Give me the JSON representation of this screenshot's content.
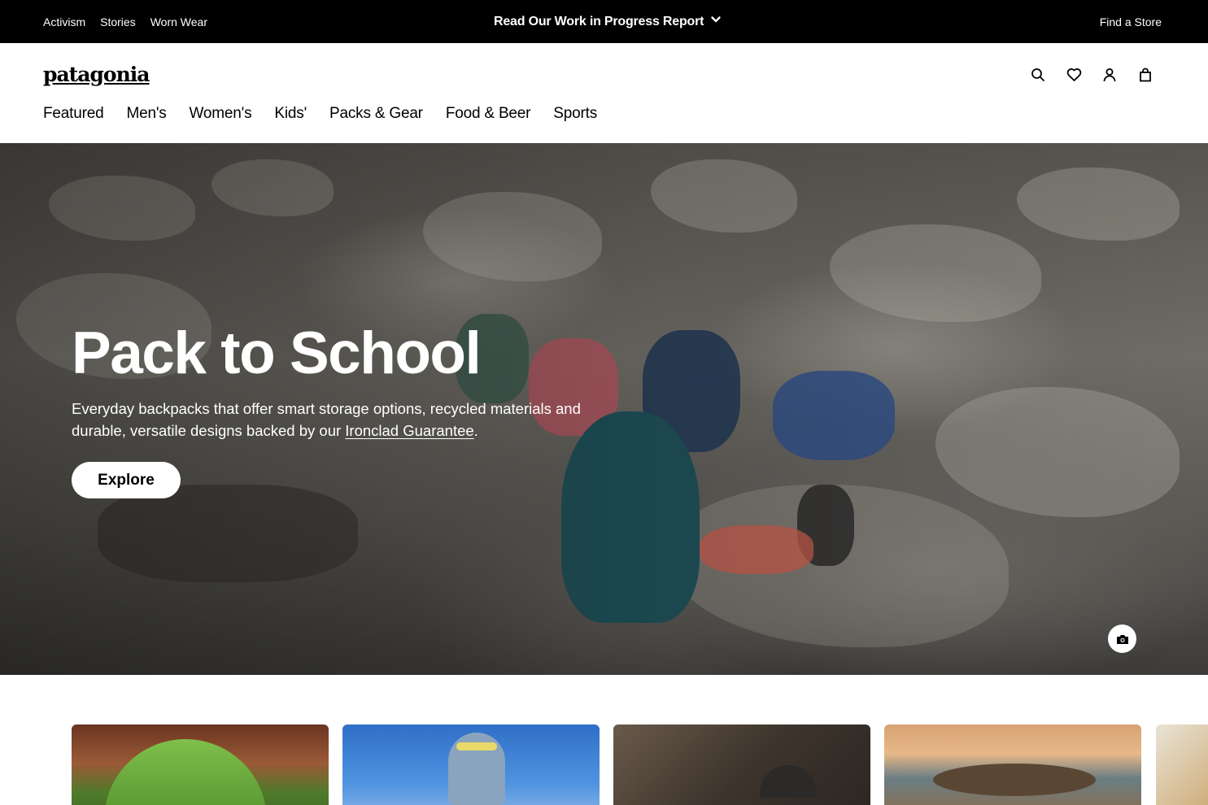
{
  "topbar": {
    "links": [
      "Activism",
      "Stories",
      "Worn Wear"
    ],
    "announcement": "Read Our Work in Progress Report",
    "find_store": "Find a Store"
  },
  "header": {
    "logo": "patagonia",
    "nav": [
      "Featured",
      "Men's",
      "Women's",
      "Kids'",
      "Packs & Gear",
      "Food & Beer",
      "Sports"
    ],
    "icons": [
      "search-icon",
      "heart-icon",
      "account-icon",
      "bag-icon"
    ]
  },
  "hero": {
    "title": "Pack to School",
    "subtitle_before": "Everyday backpacks that offer smart storage options, recycled materials and durable, versatile designs backed by our ",
    "subtitle_link": "Ironclad Guarantee",
    "subtitle_after": ".",
    "cta": "Explore"
  },
  "colors": {
    "topbar_bg": "#000000",
    "accent_text": "#ffffff"
  }
}
